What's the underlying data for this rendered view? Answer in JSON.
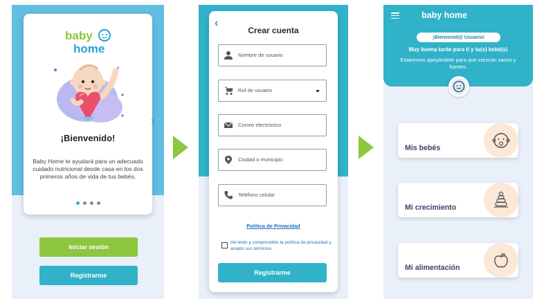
{
  "brand": {
    "logo_top": "baby",
    "logo_bottom": "home",
    "logo_inline": "baby home"
  },
  "screen1": {
    "title": "¡Bienvenido!",
    "description": "Baby Home te ayudará para un adecuado cuidado nutricional desde casa en los dos primeros años de vida de tus bebés.",
    "next_icon": "chevron-right-icon",
    "pages": 4,
    "active_page": 1,
    "login_label": "Iniciar sesión",
    "register_label": "Registrarme"
  },
  "screen2": {
    "title": "Crear cuenta",
    "back_icon": "chevron-left-icon",
    "fields": {
      "username": {
        "placeholder": "Nombre de usuario",
        "icon": "user-icon"
      },
      "role": {
        "placeholder": "Rol de usuario",
        "icon": "stroller-icon"
      },
      "email": {
        "placeholder": "Correo electrónico",
        "icon": "envelope-icon"
      },
      "city": {
        "placeholder": "Ciudad o municipio",
        "icon": "location-pin-icon"
      },
      "phone": {
        "placeholder": "Teléfono celular",
        "icon": "phone-icon"
      }
    },
    "privacy_link": "Política de Privacidad",
    "terms_text": "He leído y comprendido la política de privacidad y acepto sus términos.",
    "terms_checked": false,
    "register_label": "Registrarme"
  },
  "screen3": {
    "menu_icon": "hamburger-menu-icon",
    "welcome_pill": "¡Bienvenid@ Usuario!",
    "greeting": "Muy buena tarde para ti y tu(s) bebé(s)",
    "subtitle": "Estaremos apoyándote para que crezcan sanos y fuertes.",
    "avatar_icon": "baby-face-icon",
    "items": [
      {
        "label": "Mis bebés",
        "icon": "baby-face-icon"
      },
      {
        "label": "Mi crecimiento",
        "icon": "stacking-rings-icon"
      },
      {
        "label": "Mi alimentación",
        "icon": "apple-icon"
      }
    ]
  },
  "colors": {
    "sky_blue": "#62bde3",
    "teal": "#30b2c9",
    "green": "#8dc63f",
    "light_bg": "#e9f0f9",
    "peach": "#fbe8d6",
    "link_blue": "#1f70b8"
  }
}
